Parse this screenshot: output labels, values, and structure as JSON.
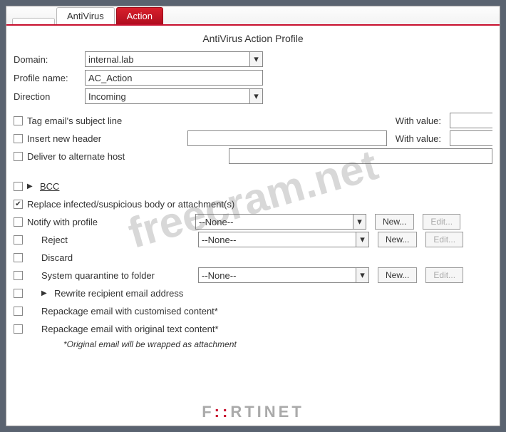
{
  "tabs": {
    "blank": "",
    "antivirus": "AntiVirus",
    "action": "Action"
  },
  "title": "AntiVirus Action Profile",
  "fields": {
    "domain_label": "Domain:",
    "domain_value": "internal.lab",
    "profile_label": "Profile name:",
    "profile_value": "AC_Action",
    "direction_label": "Direction",
    "direction_value": "Incoming"
  },
  "options": {
    "tag_subject": "Tag email's subject line",
    "with_value1": "With value:",
    "insert_header": "Insert new header",
    "with_value2": "With value:",
    "deliver_alt": "Deliver to alternate host",
    "bcc": "BCC",
    "replace": "Replace infected/suspicious body or attachment(s)",
    "notify": "Notify with profile",
    "reject": "Reject",
    "discard": "Discard",
    "sys_quarantine": "System quarantine to folder",
    "rewrite": "Rewrite recipient email address",
    "repackage_custom": "Repackage email with customised content*",
    "repackage_orig": "Repackage email with original text content*",
    "footnote": "*Original email will be wrapped as attachment"
  },
  "none": "--None--",
  "buttons": {
    "new": "New...",
    "edit": "Edit..."
  },
  "watermark": "freecram.net",
  "logo_parts": {
    "p1": "F",
    "p2": "::",
    "p3": "RTINET"
  }
}
